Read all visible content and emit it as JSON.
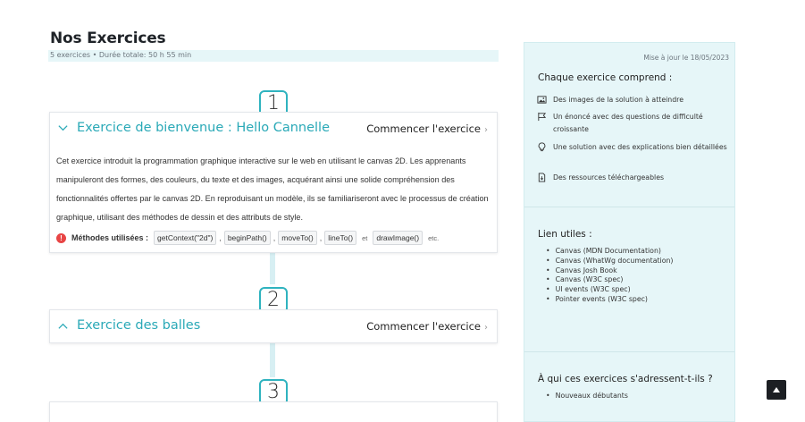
{
  "page": {
    "title": "Nos Exercices",
    "subtitle": "5 exercices • Durée totale: 50 h 55 min"
  },
  "steps": [
    "1",
    "2",
    "3"
  ],
  "exercises": [
    {
      "title": "Exercice de bienvenue : Hello Cannelle",
      "start_label": "Commencer l'exercice",
      "description": "Cet exercice introduit la programmation graphique interactive sur le web en utilisant le canvas 2D. Les apprenants manipuleront des formes, des couleurs, du texte et des images, acquérant ainsi une solide compréhension des fonctionnalités offertes par le canvas 2D. En reproduisant un modèle, ils se familiariseront avec le processus de création graphique, utilisant des méthodes de dessin et des attributs de style.",
      "methods_label": "Méthodes utilisées :",
      "methods": [
        "getContext(\"2d\")",
        "beginPath()",
        "moveTo()",
        "lineTo()",
        "drawImage()"
      ],
      "methods_and": "et",
      "methods_etc": "etc.",
      "expanded": true
    },
    {
      "title": "Exercice des balles",
      "start_label": "Commencer l'exercice",
      "expanded": false
    }
  ],
  "sidebar": {
    "updated": "Mise à jour le 18/05/2023",
    "includes_title": "Chaque exercice comprend :",
    "includes": [
      {
        "icon": "image-icon",
        "text": "Des images de la solution à atteindre"
      },
      {
        "icon": "flag-icon",
        "text": "Un énoncé avec des questions de difficulté croissante"
      },
      {
        "icon": "lightbulb-icon",
        "text": "Une solution avec des explications bien détaillées"
      },
      {
        "icon": "file-icon",
        "text": "Des ressources téléchargeables"
      }
    ],
    "links_title": "Lien utiles :",
    "links": [
      "Canvas (MDN Documentation)",
      "Canvas (WhatWg documentation)",
      "Canvas Josh Book",
      "Canvas (W3C spec)",
      "UI events (W3C spec)",
      "Pointer events (W3C spec)"
    ],
    "audience_title": "À qui ces exercices s'adressent-t-ils ?",
    "audience": [
      "Nouveaux débutants"
    ]
  },
  "colors": {
    "accent": "#2aa9b7",
    "sidebar_bg": "#e6f6f8",
    "warning": "#e84545"
  }
}
